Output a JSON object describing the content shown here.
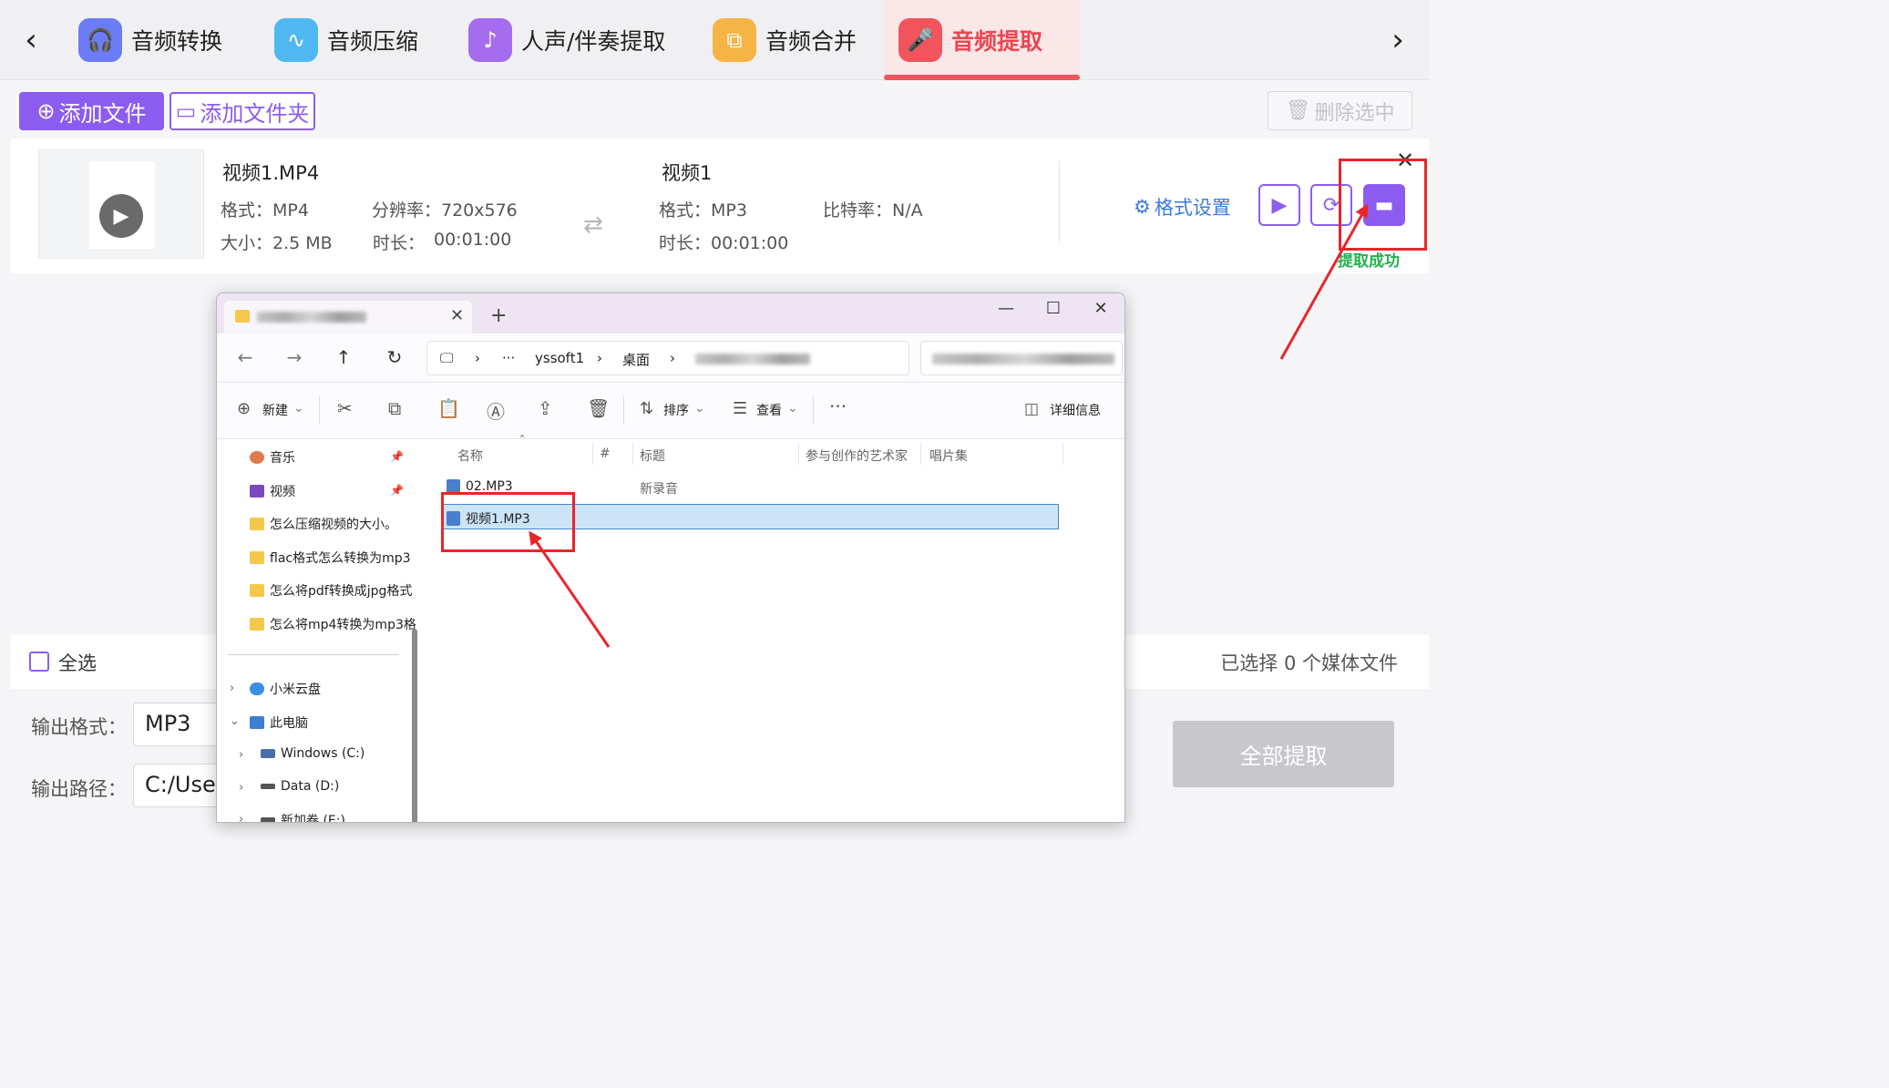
{
  "tabs": [
    {
      "label": "音频转换",
      "icon": "headphones-icon",
      "color": "#6c7cf5",
      "active": false
    },
    {
      "label": "音频压缩",
      "icon": "waveform-icon",
      "color": "#4fb8f0",
      "active": false
    },
    {
      "label": "人声/伴奏提取",
      "icon": "voice-icon",
      "color": "#a56cf0",
      "active": false
    },
    {
      "label": "音频合并",
      "icon": "merge-icon",
      "color": "#f5b445",
      "active": false
    },
    {
      "label": "音频提取",
      "icon": "microphone-icon",
      "color": "#f0555d",
      "active": true
    }
  ],
  "toolbar": {
    "add_file": "添加文件",
    "add_folder": "添加文件夹",
    "delete_selected": "删除选中"
  },
  "file_card": {
    "source": {
      "name": "视频1.MP4",
      "format": "格式：MP4",
      "size": "大小：2.5 MB",
      "resolution": "分辨率：720x576",
      "duration_label": "时长：",
      "duration": "00:01:00"
    },
    "output": {
      "name": "视频1",
      "format": "格式：MP3",
      "bitrate": "比特率：N/A",
      "duration": "时长：00:01:00"
    },
    "format_settings": "格式设置",
    "status": "提取成功"
  },
  "bottom": {
    "select_all": "全选",
    "selected_count": "已选择 0 个媒体文件",
    "output_format_label": "输出格式：",
    "output_format_value": "MP3",
    "output_path_label": "输出路径：",
    "output_path_value": "C:/Users/",
    "extract_all": "全部提取"
  },
  "explorer": {
    "breadcrumbs": [
      "yssoft1",
      "桌面"
    ],
    "commands": {
      "new": "新建",
      "sort": "排序",
      "view": "查看",
      "details": "详细信息"
    },
    "sidebar": [
      {
        "label": "音乐",
        "pinned": true
      },
      {
        "label": "视频",
        "pinned": true
      },
      {
        "label": "怎么压缩视频的大小。"
      },
      {
        "label": "flac格式怎么转换为mp3"
      },
      {
        "label": "怎么将pdf转换成jpg格式"
      },
      {
        "label": "怎么将mp4转换为mp3格"
      },
      {
        "label": "小米云盘"
      },
      {
        "label": "此电脑"
      },
      {
        "label": "Windows (C:)"
      },
      {
        "label": "Data (D:)"
      },
      {
        "label": "新加卷 (E:)"
      }
    ],
    "columns": [
      "名称",
      "#",
      "标题",
      "参与创作的艺术家",
      "唱片集"
    ],
    "files": [
      {
        "name": "02.MP3",
        "title": "新录音",
        "selected": false
      },
      {
        "name": "视频1.MP3",
        "title": "",
        "selected": true
      }
    ]
  }
}
